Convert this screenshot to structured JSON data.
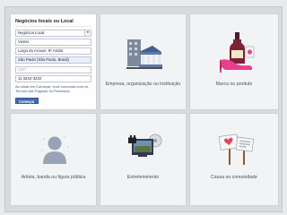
{
  "categories": [
    {
      "key": "local",
      "label": "Negócios locais ou Local"
    },
    {
      "key": "company",
      "label": "Empresa, organização ou instituição"
    },
    {
      "key": "brand",
      "label": "Marca ou produto"
    },
    {
      "key": "artist",
      "label": "Artista, banda ou figura pública"
    },
    {
      "key": "entertainment",
      "label": "Entretenimento"
    },
    {
      "key": "cause",
      "label": "Causa ou comunidade"
    }
  ],
  "form": {
    "category_value": "Negócios Local",
    "name_value": "Veüter",
    "address_value": "Largo do Arouxe, 8º Andar",
    "city_value": "São Paulo (São Paulo, Brasil)",
    "zip_placeholder": "CEP",
    "phone_value": "11 3232-3232",
    "terms_prefix": "Ao clicar em Começar, você concorda com",
    "terms_link_prefix": "os ",
    "terms_link": "Termos das Páginas do Facebook",
    "terms_suffix": ".",
    "start_button": "Começar"
  },
  "icons": {
    "company": "building-icon",
    "brand": "shoe-and-bottle-icon",
    "artist": "person-silhouette-icon",
    "entertainment": "movie-and-tv-icon",
    "cause": "sign-boards-icon"
  }
}
